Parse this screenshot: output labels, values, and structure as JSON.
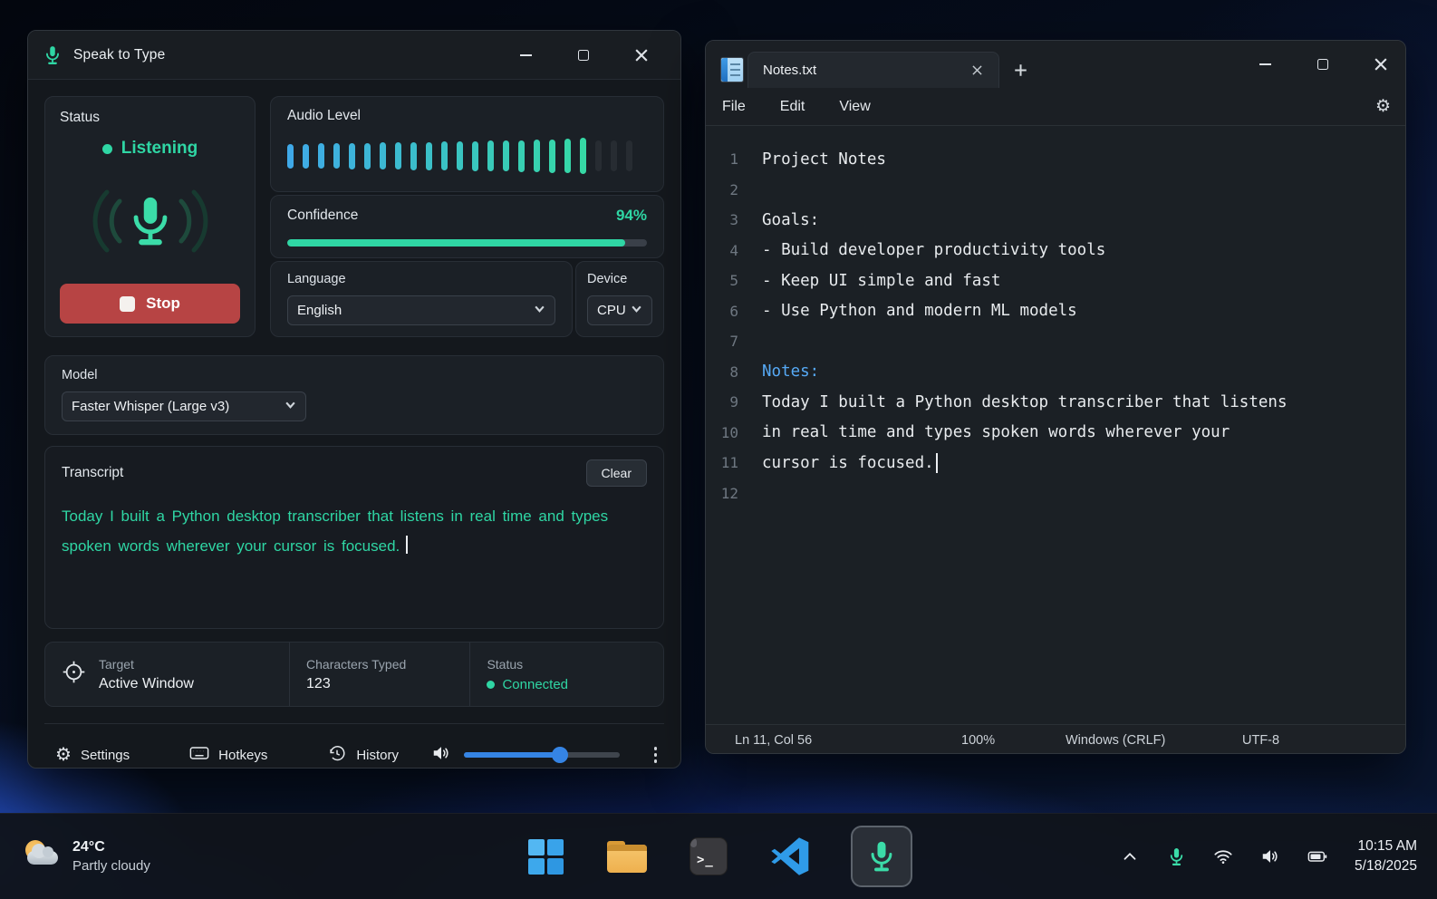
{
  "colors": {
    "accent_teal": "#2fd6a4",
    "teal_dim_ring": "#1e4a3c",
    "bar_blue": "#3fa9e8",
    "bar_teal": "#36d9a5",
    "bar_dim": "#272c32",
    "stop_red": "#b74444",
    "volume_blue": "#3584e4",
    "note_blue": "#56a9f5"
  },
  "speak_app": {
    "title": "Speak to Type",
    "status": {
      "label": "Status",
      "state": "Listening",
      "stop_label": "Stop"
    },
    "audio": {
      "label": "Audio Level",
      "active_heights": [
        27,
        27,
        28,
        28,
        29,
        29,
        30,
        30,
        31,
        31,
        32,
        32,
        33,
        34,
        34,
        35,
        36,
        37,
        38,
        40
      ],
      "dim_heights": [
        34,
        34,
        34
      ]
    },
    "confidence": {
      "label": "Confidence",
      "value": "94%",
      "percent": 94
    },
    "language": {
      "label": "Language",
      "value": "English"
    },
    "device": {
      "label": "Device",
      "value": "CPU"
    },
    "model": {
      "label": "Model",
      "value": "Faster Whisper (Large v3)"
    },
    "transcript": {
      "label": "Transcript",
      "clear_label": "Clear",
      "text": "Today I built a Python desktop transcriber that listens in real time and types spoken words wherever your cursor is focused."
    },
    "stats": {
      "target_label": "Target",
      "target_value": "Active Window",
      "characters_label": "Characters Typed",
      "characters_value": "123",
      "status_label": "Status",
      "status_value": "Connected"
    },
    "toolbar": {
      "settings_label": "Settings",
      "hotkeys_label": "Hotkeys",
      "history_label": "History",
      "volume_percent": 62
    }
  },
  "notepad": {
    "tab_title": "Notes.txt",
    "menus": [
      "File",
      "Edit",
      "View"
    ],
    "lines": [
      {
        "n": 1,
        "text": "Project Notes"
      },
      {
        "n": 2,
        "text": ""
      },
      {
        "n": 3,
        "text": "Goals:"
      },
      {
        "n": 4,
        "text": "- Build developer productivity tools"
      },
      {
        "n": 5,
        "text": "- Keep UI simple and fast"
      },
      {
        "n": 6,
        "text": "- Use Python and modern ML models"
      },
      {
        "n": 7,
        "text": ""
      },
      {
        "n": 8,
        "text": "Notes:",
        "accent": true
      },
      {
        "n": 9,
        "text": "Today I built a Python desktop transcriber that listens"
      },
      {
        "n": 10,
        "text": "in real time and types spoken words wherever your"
      },
      {
        "n": 11,
        "text": "cursor is focused.",
        "caret": true
      },
      {
        "n": 12,
        "text": ""
      }
    ],
    "statusbar": {
      "position": "Ln 11, Col 56",
      "zoom": "100%",
      "line_ending": "Windows (CRLF)",
      "encoding": "UTF-8"
    }
  },
  "taskbar": {
    "weather": {
      "temp": "24°C",
      "condition": "Partly cloudy"
    },
    "clock": {
      "time": "10:15 AM",
      "date": "5/18/2025"
    }
  }
}
